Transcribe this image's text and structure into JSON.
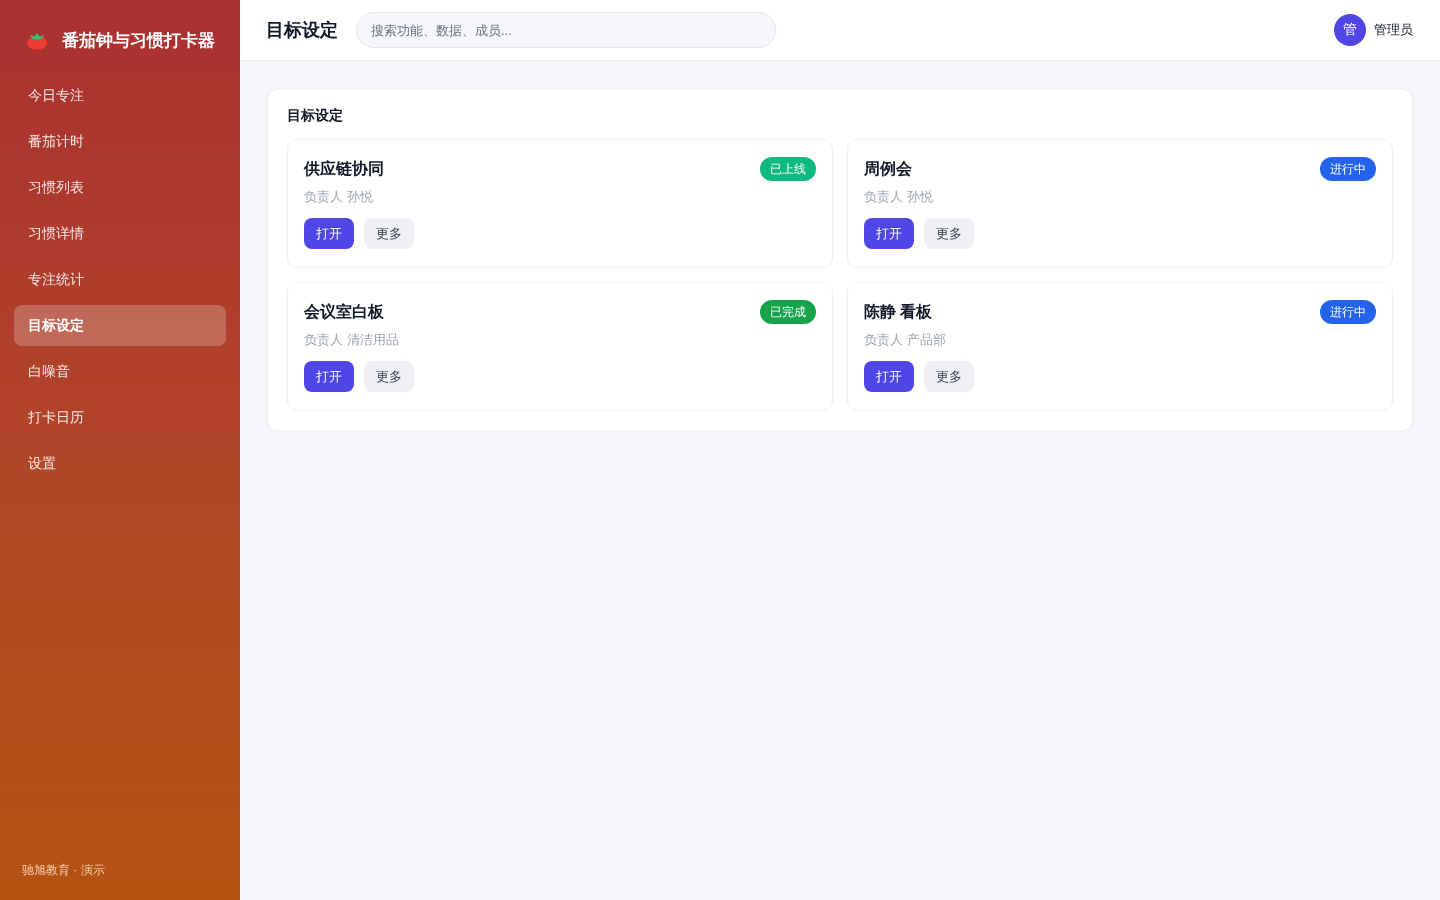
{
  "sidebar": {
    "brand": "番茄钟与习惯打卡器",
    "items": [
      {
        "label": "今日专注",
        "selected": false
      },
      {
        "label": "番茄计时",
        "selected": false
      },
      {
        "label": "习惯列表",
        "selected": false
      },
      {
        "label": "习惯详情",
        "selected": false
      },
      {
        "label": "专注统计",
        "selected": false
      },
      {
        "label": "目标设定",
        "selected": true
      },
      {
        "label": "白噪音",
        "selected": false
      },
      {
        "label": "打卡日历",
        "selected": false
      },
      {
        "label": "设置",
        "selected": false
      }
    ],
    "footer": "驰旭教育 · 演示"
  },
  "header": {
    "title": "目标设定",
    "search": {
      "placeholder": "搜索功能、数据、成员..."
    },
    "user": {
      "avatar": "管",
      "name": "管理员"
    }
  },
  "panel": {
    "title": "目标设定",
    "cards": [
      {
        "title": "供应链协同",
        "owner": "负责人 孙悦",
        "status": {
          "label": "已上线",
          "color": "#10b981"
        },
        "buttons": [
          {
            "label": "打开",
            "kind": "primary"
          },
          {
            "label": "更多",
            "kind": "secondary"
          }
        ]
      },
      {
        "title": "周例会",
        "owner": "负责人 孙悦",
        "status": {
          "label": "进行中",
          "color": "#2563eb"
        },
        "buttons": [
          {
            "label": "打开",
            "kind": "primary"
          },
          {
            "label": "更多",
            "kind": "secondary"
          }
        ]
      },
      {
        "title": "会议室白板",
        "owner": "负责人 清洁用品",
        "status": {
          "label": "已完成",
          "color": "#16a34a"
        },
        "buttons": [
          {
            "label": "打开",
            "kind": "primary"
          },
          {
            "label": "更多",
            "kind": "secondary"
          }
        ]
      },
      {
        "title": "陈静 看板",
        "owner": "负责人 产品部",
        "status": {
          "label": "进行中",
          "color": "#2563eb"
        },
        "buttons": [
          {
            "label": "打开",
            "kind": "primary"
          },
          {
            "label": "更多",
            "kind": "secondary"
          }
        ]
      }
    ]
  }
}
